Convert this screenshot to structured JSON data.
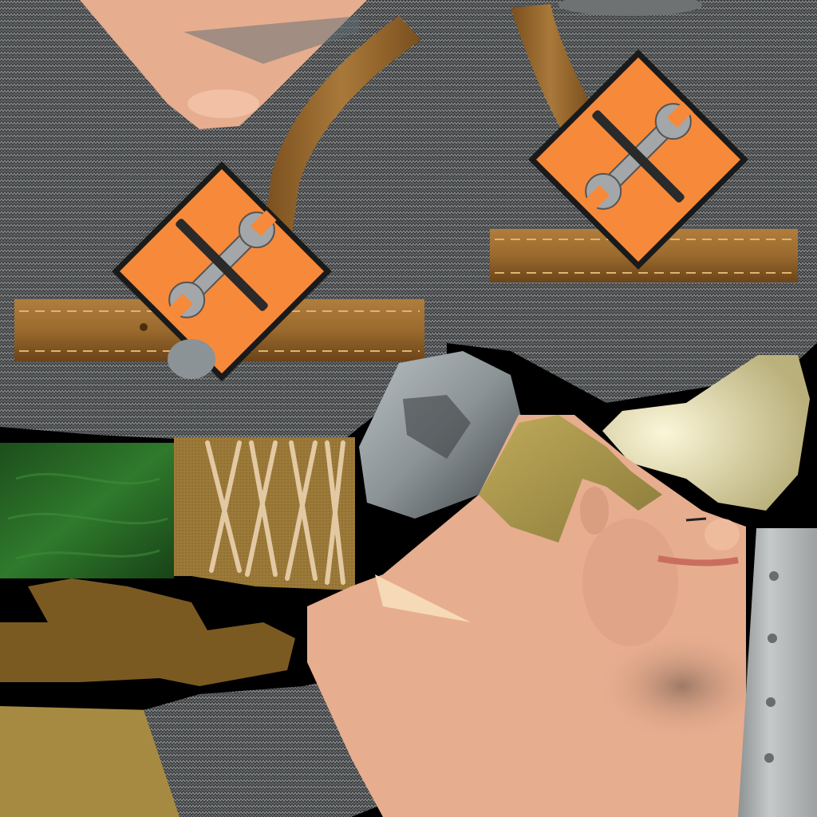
{
  "texture_atlas": {
    "visible_text": "",
    "colors": {
      "background": "#000000",
      "knit_fabric_dark": "#3a3b3c",
      "knit_fabric_light": "#8e9193",
      "leather_strap": "#9a6a2e",
      "leather_dark": "#6b4418",
      "warning_sign_orange": "#f7893a",
      "warning_sign_border": "#1a1a1a",
      "tool_metal": "#a4a7a9",
      "tool_handle": "#2a2a2a",
      "skin": "#e7ad8f",
      "skin_shadow": "#d5967a",
      "hair_blond": "#a8954a",
      "stubble": "#9e7a66",
      "green_fabric": "#1f5a1e",
      "canvas_tan": "#9c7a39",
      "lace_cord": "#e3c9a3",
      "brown_cloth": "#7b5a22",
      "steel_gray": "#8b9396",
      "cap_cream": "#e2dcae",
      "metal_plate": "#b9bcbc"
    },
    "regions": [
      {
        "name": "chin-skin-patch"
      },
      {
        "name": "knit-vest-front-left"
      },
      {
        "name": "knit-vest-front-right"
      },
      {
        "name": "leather-suspender-left"
      },
      {
        "name": "leather-suspender-right"
      },
      {
        "name": "tool-warning-sign-left",
        "icon": "wrench-screwdriver-icon"
      },
      {
        "name": "tool-warning-sign-right",
        "icon": "wrench-screwdriver-icon"
      },
      {
        "name": "green-fabric-patch"
      },
      {
        "name": "laced-canvas-patch"
      },
      {
        "name": "brown-cloth-patch"
      },
      {
        "name": "tan-cloth-strip"
      },
      {
        "name": "knit-sleeve-patch"
      },
      {
        "name": "steel-helmet-patch"
      },
      {
        "name": "cream-cap-patch"
      },
      {
        "name": "face-skin-head"
      },
      {
        "name": "blond-hair"
      },
      {
        "name": "metal-plate-strip"
      }
    ]
  }
}
